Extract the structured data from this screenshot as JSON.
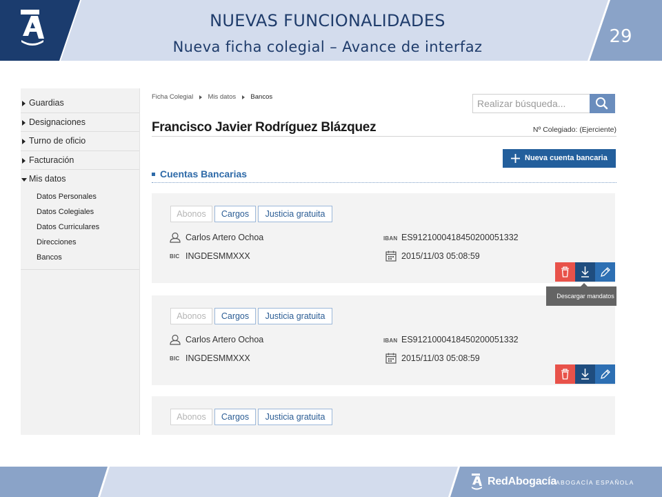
{
  "slide": {
    "title": "NUEVAS FUNCIONALIDADES",
    "subtitle": "Nueva ficha colegial – Avance de interfaz",
    "page_number": "29",
    "footer_brand": "RedAbogacía",
    "footer_sub": "ABOGACÍA ESPAÑOLA",
    "colors": {
      "navy": "#1b3c6e",
      "pale_blue": "#d3dced",
      "steel_blue": "#8aa3c8",
      "title_text": "#1f3c6b"
    }
  },
  "sidebar": {
    "items": [
      {
        "label": "Guardias"
      },
      {
        "label": "Designaciones"
      },
      {
        "label": "Turno de oficio"
      },
      {
        "label": "Facturación"
      },
      {
        "label": "Mis datos"
      }
    ],
    "subitems": [
      {
        "label": "Datos Personales"
      },
      {
        "label": "Datos Colegiales"
      },
      {
        "label": "Datos Curriculares"
      },
      {
        "label": "Direcciones"
      },
      {
        "label": "Bancos"
      }
    ]
  },
  "breadcrumb": {
    "items": [
      "Ficha Colegial",
      "Mis datos",
      "Bancos"
    ]
  },
  "search": {
    "placeholder": "Realizar búsqueda..."
  },
  "profile": {
    "name": "Francisco Javier Rodríguez Blázquez",
    "colegiado": "Nº Colegiado: (Ejerciente)"
  },
  "actions": {
    "new_account": "Nueva cuenta bancaria"
  },
  "section": {
    "title": "Cuentas Bancarias"
  },
  "tabs": {
    "abonos": "Abonos",
    "cargos": "Cargos",
    "justicia": "Justicia gratuita"
  },
  "labels": {
    "iban": "IBAN",
    "bic": "BIC"
  },
  "accounts": [
    {
      "holder": "Carlos Artero Ochoa",
      "iban": "ES9121000418450200051332",
      "bic": "INGDESMMXXX",
      "date": "2015/11/03 05:08:59"
    },
    {
      "holder": "Carlos Artero Ochoa",
      "iban": "ES9121000418450200051332",
      "bic": "INGDESMMXXX",
      "date": "2015/11/03 05:08:59"
    }
  ],
  "tooltip": {
    "text": "Descargar mandatos"
  }
}
